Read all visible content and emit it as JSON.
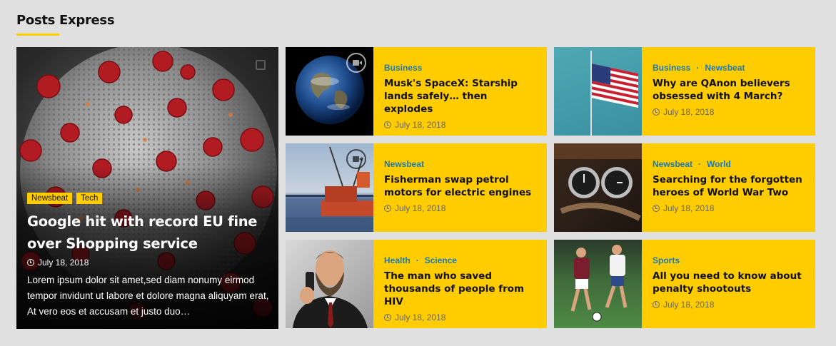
{
  "section": {
    "title": "Posts Express",
    "accent": "#ffcc00"
  },
  "featured": {
    "categories": [
      "Newsbeat",
      "Tech"
    ],
    "title": "Google hit with record EU fine over Shopping service",
    "date": "July 18, 2018",
    "excerpt": "Lorem ipsum dolor sit amet,sed diam nonumy eirmod tempor invidunt ut labore et dolore magna aliquyam erat, At vero eos et accusam et justo duo…"
  },
  "posts": [
    {
      "categories": [
        "Business"
      ],
      "title": "Musk's SpaceX: Starship lands safely… then explodes",
      "date": "July 18, 2018",
      "image": "earth-image"
    },
    {
      "categories": [
        "Business",
        "Newsbeat"
      ],
      "title": "Why are QAnon believers obsessed with 4 March?",
      "date": "July 18, 2018",
      "image": "flag-image"
    },
    {
      "categories": [
        "Newsbeat"
      ],
      "title": "Fisherman swap petrol motors for electric engines",
      "date": "July 18, 2018",
      "image": "harbor-image"
    },
    {
      "categories": [
        "Newsbeat",
        "World"
      ],
      "title": "Searching for the forgotten heroes of World War Two",
      "date": "July 18, 2018",
      "image": "watches-image"
    },
    {
      "categories": [
        "Health",
        "Science"
      ],
      "title": "The man who saved thousands of people from HIV",
      "date": "July 18, 2018",
      "image": "man-phone-image"
    },
    {
      "categories": [
        "Sports"
      ],
      "title": "All you need to know about penalty shootouts",
      "date": "July 18, 2018",
      "image": "soccer-image"
    }
  ],
  "colors": {
    "card_bg": "#ffcc00",
    "category_link": "#1a7ab5",
    "page_bg": "#e0e0e0"
  }
}
